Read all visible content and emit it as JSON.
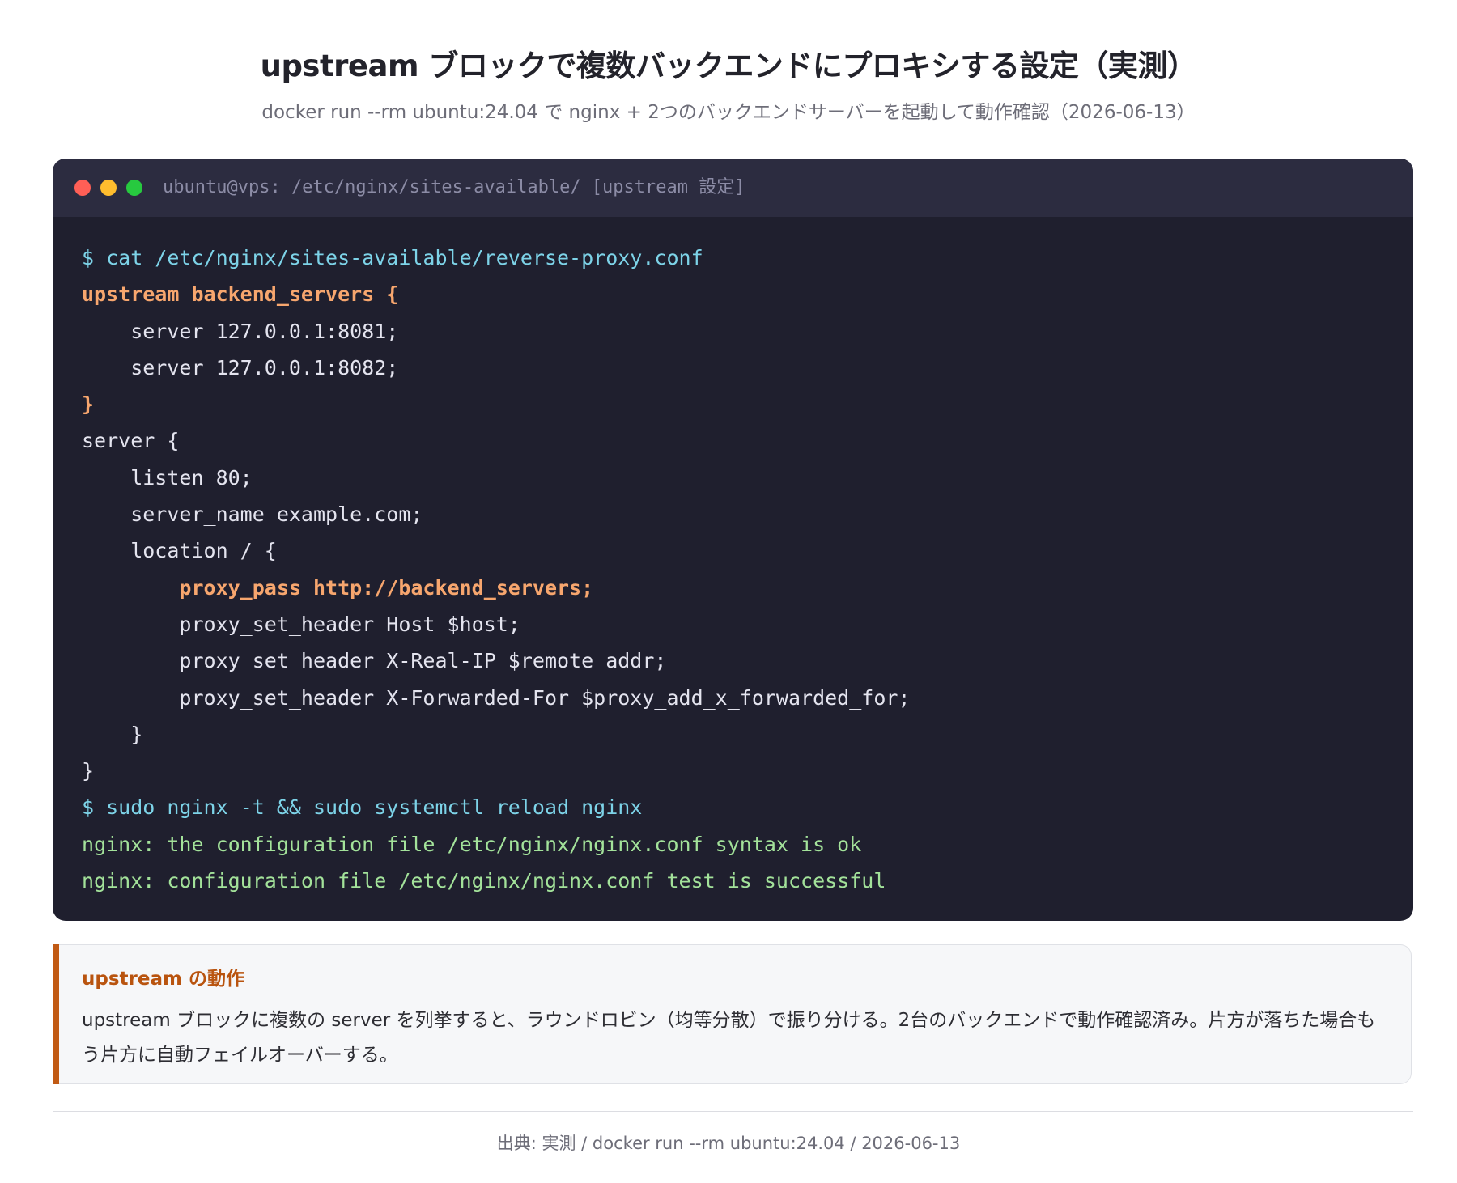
{
  "header": {
    "title": "upstream ブロックで複数バックエンドにプロキシする設定（実測）",
    "subtitle": "docker run --rm ubuntu:24.04 で nginx + 2つのバックエンドサーバーを起動して動作確認（2026-06-13）"
  },
  "terminal": {
    "title": "ubuntu@vps: /etc/nginx/sites-available/ [upstream 設定]",
    "window_controls": [
      "close",
      "minimize",
      "maximize"
    ],
    "lines": [
      "$ cat /etc/nginx/sites-available/reverse-proxy.conf",
      "upstream backend_servers {",
      "    server 127.0.0.1:8081;",
      "    server 127.0.0.1:8082;",
      "}",
      "server {",
      "    listen 80;",
      "    server_name example.com;",
      "    location / {",
      "        proxy_pass http://backend_servers;",
      "        proxy_set_header Host $host;",
      "        proxy_set_header X-Real-IP $remote_addr;",
      "        proxy_set_header X-Forwarded-For $proxy_add_x_forwarded_for;",
      "    }",
      "}",
      "$ sudo nginx -t && sudo systemctl reload nginx",
      "nginx: the configuration file /etc/nginx/nginx.conf syntax is ok",
      "nginx: configuration file /etc/nginx/nginx.conf test is successful"
    ]
  },
  "note": {
    "heading": "upstream の動作",
    "text": "upstream ブロックに複数の server を列挙すると、ラウンドロビン（均等分散）で振り分ける。2台のバックエンドで動作確認済み。片方が落ちた場合もう片方に自動フェイルオーバーする。"
  },
  "footer": {
    "source": "出典: 実測 / docker run --rm ubuntu:24.04 / 2026-06-13"
  },
  "colors": {
    "terminal_bg": "#1f1f2e",
    "titlebar_bg": "#2c2c40",
    "command": "#7dd3e8",
    "keyword": "#f7a66e",
    "success": "#a3e29a",
    "accent": "#c15a14"
  }
}
